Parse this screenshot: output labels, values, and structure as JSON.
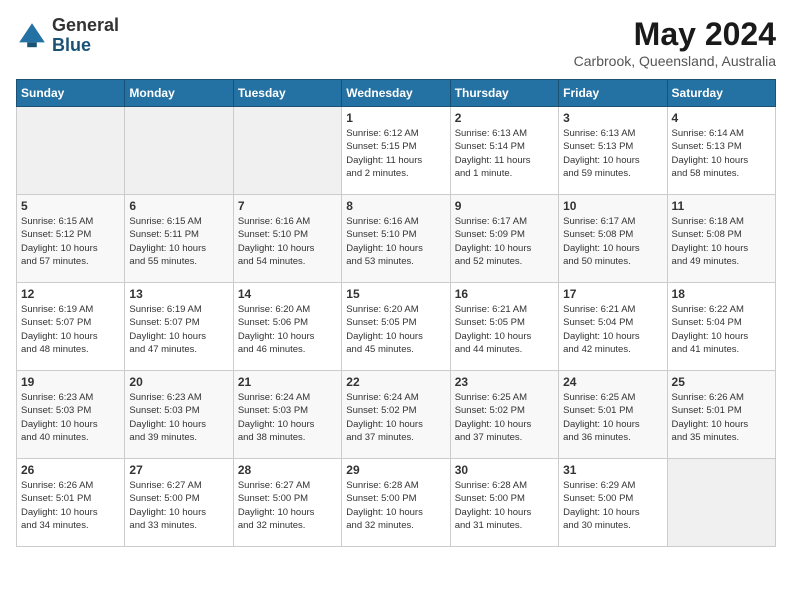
{
  "logo": {
    "general": "General",
    "blue": "Blue"
  },
  "title": {
    "month_year": "May 2024",
    "location": "Carbrook, Queensland, Australia"
  },
  "days_of_week": [
    "Sunday",
    "Monday",
    "Tuesday",
    "Wednesday",
    "Thursday",
    "Friday",
    "Saturday"
  ],
  "weeks": [
    [
      {
        "day": "",
        "info": ""
      },
      {
        "day": "",
        "info": ""
      },
      {
        "day": "",
        "info": ""
      },
      {
        "day": "1",
        "info": "Sunrise: 6:12 AM\nSunset: 5:15 PM\nDaylight: 11 hours\nand 2 minutes."
      },
      {
        "day": "2",
        "info": "Sunrise: 6:13 AM\nSunset: 5:14 PM\nDaylight: 11 hours\nand 1 minute."
      },
      {
        "day": "3",
        "info": "Sunrise: 6:13 AM\nSunset: 5:13 PM\nDaylight: 10 hours\nand 59 minutes."
      },
      {
        "day": "4",
        "info": "Sunrise: 6:14 AM\nSunset: 5:13 PM\nDaylight: 10 hours\nand 58 minutes."
      }
    ],
    [
      {
        "day": "5",
        "info": "Sunrise: 6:15 AM\nSunset: 5:12 PM\nDaylight: 10 hours\nand 57 minutes."
      },
      {
        "day": "6",
        "info": "Sunrise: 6:15 AM\nSunset: 5:11 PM\nDaylight: 10 hours\nand 55 minutes."
      },
      {
        "day": "7",
        "info": "Sunrise: 6:16 AM\nSunset: 5:10 PM\nDaylight: 10 hours\nand 54 minutes."
      },
      {
        "day": "8",
        "info": "Sunrise: 6:16 AM\nSunset: 5:10 PM\nDaylight: 10 hours\nand 53 minutes."
      },
      {
        "day": "9",
        "info": "Sunrise: 6:17 AM\nSunset: 5:09 PM\nDaylight: 10 hours\nand 52 minutes."
      },
      {
        "day": "10",
        "info": "Sunrise: 6:17 AM\nSunset: 5:08 PM\nDaylight: 10 hours\nand 50 minutes."
      },
      {
        "day": "11",
        "info": "Sunrise: 6:18 AM\nSunset: 5:08 PM\nDaylight: 10 hours\nand 49 minutes."
      }
    ],
    [
      {
        "day": "12",
        "info": "Sunrise: 6:19 AM\nSunset: 5:07 PM\nDaylight: 10 hours\nand 48 minutes."
      },
      {
        "day": "13",
        "info": "Sunrise: 6:19 AM\nSunset: 5:07 PM\nDaylight: 10 hours\nand 47 minutes."
      },
      {
        "day": "14",
        "info": "Sunrise: 6:20 AM\nSunset: 5:06 PM\nDaylight: 10 hours\nand 46 minutes."
      },
      {
        "day": "15",
        "info": "Sunrise: 6:20 AM\nSunset: 5:05 PM\nDaylight: 10 hours\nand 45 minutes."
      },
      {
        "day": "16",
        "info": "Sunrise: 6:21 AM\nSunset: 5:05 PM\nDaylight: 10 hours\nand 44 minutes."
      },
      {
        "day": "17",
        "info": "Sunrise: 6:21 AM\nSunset: 5:04 PM\nDaylight: 10 hours\nand 42 minutes."
      },
      {
        "day": "18",
        "info": "Sunrise: 6:22 AM\nSunset: 5:04 PM\nDaylight: 10 hours\nand 41 minutes."
      }
    ],
    [
      {
        "day": "19",
        "info": "Sunrise: 6:23 AM\nSunset: 5:03 PM\nDaylight: 10 hours\nand 40 minutes."
      },
      {
        "day": "20",
        "info": "Sunrise: 6:23 AM\nSunset: 5:03 PM\nDaylight: 10 hours\nand 39 minutes."
      },
      {
        "day": "21",
        "info": "Sunrise: 6:24 AM\nSunset: 5:03 PM\nDaylight: 10 hours\nand 38 minutes."
      },
      {
        "day": "22",
        "info": "Sunrise: 6:24 AM\nSunset: 5:02 PM\nDaylight: 10 hours\nand 37 minutes."
      },
      {
        "day": "23",
        "info": "Sunrise: 6:25 AM\nSunset: 5:02 PM\nDaylight: 10 hours\nand 37 minutes."
      },
      {
        "day": "24",
        "info": "Sunrise: 6:25 AM\nSunset: 5:01 PM\nDaylight: 10 hours\nand 36 minutes."
      },
      {
        "day": "25",
        "info": "Sunrise: 6:26 AM\nSunset: 5:01 PM\nDaylight: 10 hours\nand 35 minutes."
      }
    ],
    [
      {
        "day": "26",
        "info": "Sunrise: 6:26 AM\nSunset: 5:01 PM\nDaylight: 10 hours\nand 34 minutes."
      },
      {
        "day": "27",
        "info": "Sunrise: 6:27 AM\nSunset: 5:00 PM\nDaylight: 10 hours\nand 33 minutes."
      },
      {
        "day": "28",
        "info": "Sunrise: 6:27 AM\nSunset: 5:00 PM\nDaylight: 10 hours\nand 32 minutes."
      },
      {
        "day": "29",
        "info": "Sunrise: 6:28 AM\nSunset: 5:00 PM\nDaylight: 10 hours\nand 32 minutes."
      },
      {
        "day": "30",
        "info": "Sunrise: 6:28 AM\nSunset: 5:00 PM\nDaylight: 10 hours\nand 31 minutes."
      },
      {
        "day": "31",
        "info": "Sunrise: 6:29 AM\nSunset: 5:00 PM\nDaylight: 10 hours\nand 30 minutes."
      },
      {
        "day": "",
        "info": ""
      }
    ]
  ]
}
